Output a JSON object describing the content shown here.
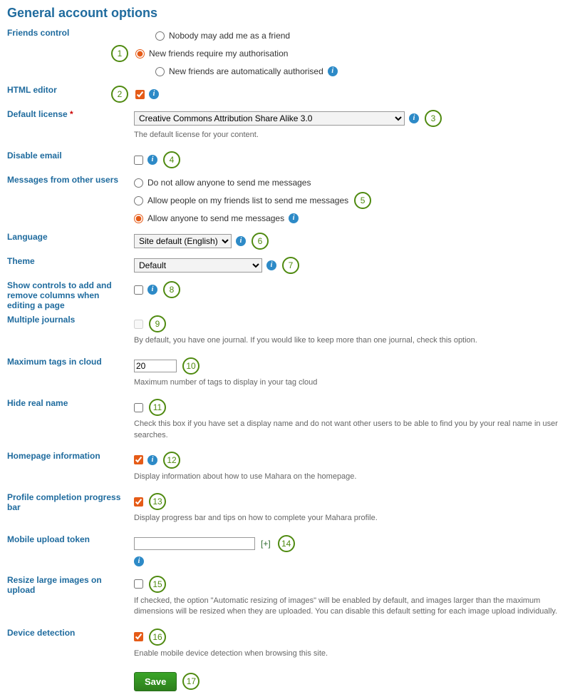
{
  "heading": "General account options",
  "friends": {
    "label": "Friends control",
    "opt_nobody": "Nobody may add me as a friend",
    "opt_auth": "New friends require my authorisation",
    "opt_auto": "New friends are automatically authorised"
  },
  "html_editor": {
    "label": "HTML editor"
  },
  "default_license": {
    "label": "Default license",
    "value": "Creative Commons Attribution Share Alike 3.0",
    "help": "The default license for your content."
  },
  "disable_email": {
    "label": "Disable email"
  },
  "messages": {
    "label": "Messages from other users",
    "opt_none": "Do not allow anyone to send me messages",
    "opt_friends": "Allow people on my friends list to send me messages",
    "opt_anyone": "Allow anyone to send me messages"
  },
  "language": {
    "label": "Language",
    "value": "Site default (English)"
  },
  "theme": {
    "label": "Theme",
    "value": "Default"
  },
  "show_controls": {
    "label": "Show controls to add and remove columns when editing a page"
  },
  "multiple_journals": {
    "label": "Multiple journals",
    "help": "By default, you have one journal. If you would like to keep more than one journal, check this option."
  },
  "max_tags": {
    "label": "Maximum tags in cloud",
    "value": "20",
    "help": "Maximum number of tags to display in your tag cloud"
  },
  "hide_real_name": {
    "label": "Hide real name",
    "help": "Check this box if you have set a display name and do not want other users to be able to find you by your real name in user searches."
  },
  "homepage_info": {
    "label": "Homepage information",
    "help": "Display information about how to use Mahara on the homepage."
  },
  "profile_completion": {
    "label": "Profile completion progress bar",
    "help": "Display progress bar and tips on how to complete your Mahara profile."
  },
  "mobile_token": {
    "label": "Mobile upload token",
    "value": ""
  },
  "resize_images": {
    "label": "Resize large images on upload",
    "help": "If checked, the option \"Automatic resizing of images\" will be enabled by default, and images larger than the maximum dimensions will be resized when they are uploaded. You can disable this default setting for each image upload individually."
  },
  "device_detection": {
    "label": "Device detection",
    "help": "Enable mobile device detection when browsing this site."
  },
  "save_label": "Save",
  "markers": {
    "m1": "1",
    "m2": "2",
    "m3": "3",
    "m4": "4",
    "m5": "5",
    "m6": "6",
    "m7": "7",
    "m8": "8",
    "m9": "9",
    "m10": "10",
    "m11": "11",
    "m12": "12",
    "m13": "13",
    "m14": "14",
    "m15": "15",
    "m16": "16",
    "m17": "17"
  },
  "plus_token": "[+]",
  "required_mark": "*"
}
